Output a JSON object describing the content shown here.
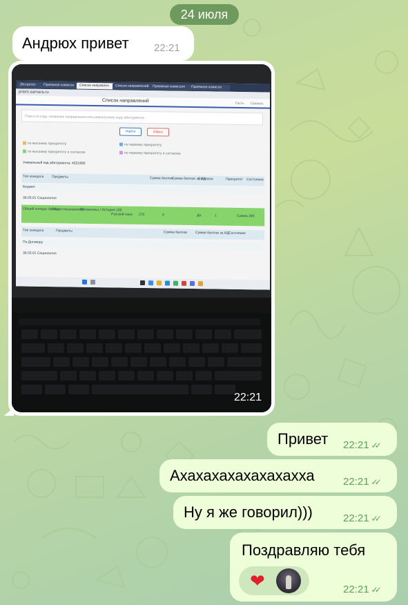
{
  "chat": {
    "date_label": "24 июля",
    "messages": [
      {
        "direction": "in",
        "text": "Андрюх привет",
        "time": "22:21"
      },
      {
        "direction": "in",
        "type": "photo",
        "time": "22:21"
      },
      {
        "direction": "out",
        "text": "Привет",
        "time": "22:21",
        "read": true
      },
      {
        "direction": "out",
        "text": "Ахахахахахахахахха",
        "time": "22:21",
        "read": true
      },
      {
        "direction": "out",
        "text": "Ну я же говорил)))",
        "time": "22:21",
        "read": true
      },
      {
        "direction": "out",
        "text": "Поздравляю тебя",
        "time": "22:21",
        "read": true,
        "reactions": [
          "heart-icon",
          "avatar"
        ]
      }
    ]
  },
  "photo_screen": {
    "tabs": [
      "(Встрети)-",
      "Приёмная комисси",
      "Список направлен",
      "Список направлений",
      "Приёмная комиссия",
      "Приёмная комисси"
    ],
    "url": "priem.samara.ru",
    "page_title": "Список направлений",
    "header_links": [
      "ЛК",
      "Гость",
      "Скачать"
    ],
    "search_placeholder": "Поиск по коду, названию направления или уникальному коду абитуриента",
    "find_button": "Найти",
    "reset_button": "Сброс",
    "legend": [
      "по высшему приоритету",
      "по первому приоритету",
      "по высшему приоритету и согласию",
      "по первому приоритету и согласию"
    ],
    "unique_code": "Уникальный код абитуриента: 4321950",
    "table1_headers": [
      "Тип конкурса",
      "Предметы",
      "Сумма баллов",
      "Сумма баллов за ИД",
      "Согласие",
      "Приоритет",
      "Состояние"
    ],
    "table1_section": "Бюджет",
    "table1_program": "39.03.01 Социология",
    "table1_row": [
      "Общий конкурс баллы",
      "Обществознание 85",
      "Математика / История 100",
      "Русский язык",
      "270",
      "0",
      "Да",
      "1",
      "Сумма 283"
    ],
    "table2_headers": [
      "Тип конкурса",
      "Предметы",
      "Сумма баллов",
      "Сумма баллов за ИД",
      "Состояние"
    ],
    "table2_section": "По Договору",
    "table2_program": "39.03.01 Социология"
  },
  "colors": {
    "incoming_bubble": "#ffffff",
    "outgoing_bubble": "#eefed9",
    "time_outgoing": "#5fa05a",
    "date_pill": "#6f9a5e",
    "green_row": "#86d46a"
  }
}
